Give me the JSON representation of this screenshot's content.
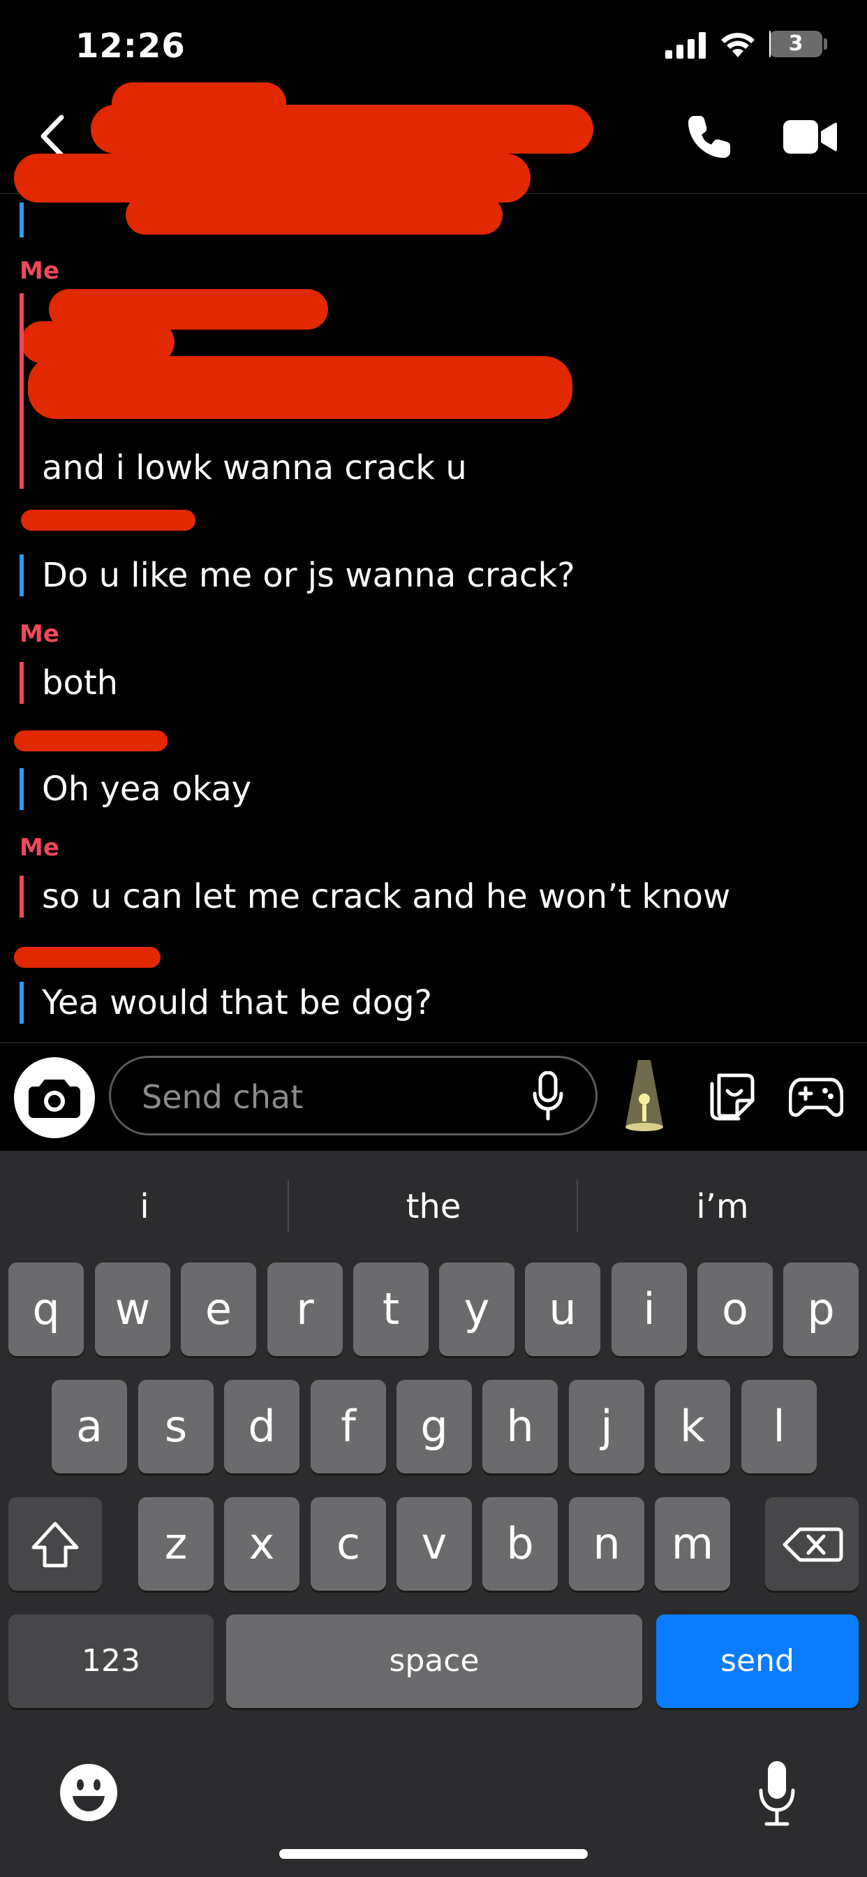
{
  "status_bar": {
    "time": "12:26",
    "battery": "3",
    "battery_level": 0.03
  },
  "header": {
    "back_icon": "chevron-left-icon",
    "call_icon": "phone-icon",
    "video_icon": "video-camera-icon"
  },
  "messages": [
    {
      "sender": "Me",
      "side": "me",
      "text": "and i lowk wanna crack u"
    },
    {
      "sender": "",
      "side": "them",
      "text": "Do u like me or js wanna crack?"
    },
    {
      "sender": "Me",
      "side": "me",
      "text": "both"
    },
    {
      "sender": "",
      "side": "them",
      "text": "Oh yea okay"
    },
    {
      "sender": "Me",
      "side": "me",
      "text": "so u can let me crack and he won’t know"
    },
    {
      "sender": "",
      "side": "them",
      "text": "Yea would that be dog?"
    }
  ],
  "composer": {
    "placeholder": "Send chat",
    "camera_icon": "camera-icon",
    "mic_icon": "microphone-icon",
    "lens_icon": "lens-lamp-icon",
    "sticker_icon": "sticker-icon",
    "game_icon": "gamepad-icon"
  },
  "keyboard": {
    "suggestions": [
      "i",
      "the",
      "i’m"
    ],
    "row1": [
      "q",
      "w",
      "e",
      "r",
      "t",
      "y",
      "u",
      "i",
      "o",
      "p"
    ],
    "row2": [
      "a",
      "s",
      "d",
      "f",
      "g",
      "h",
      "j",
      "k",
      "l"
    ],
    "row3": [
      "z",
      "x",
      "c",
      "v",
      "b",
      "n",
      "m"
    ],
    "shift_icon": "shift-icon",
    "delete_icon": "backspace-icon",
    "numbers_label": "123",
    "space_label": "space",
    "send_label": "send",
    "emoji_icon": "emoji-icon",
    "dictation_icon": "microphone-icon"
  },
  "colors": {
    "me_accent": "#f0485d",
    "them_accent": "#2d9cf4",
    "send_key": "#0a7cff",
    "redaction": "#e12800"
  }
}
